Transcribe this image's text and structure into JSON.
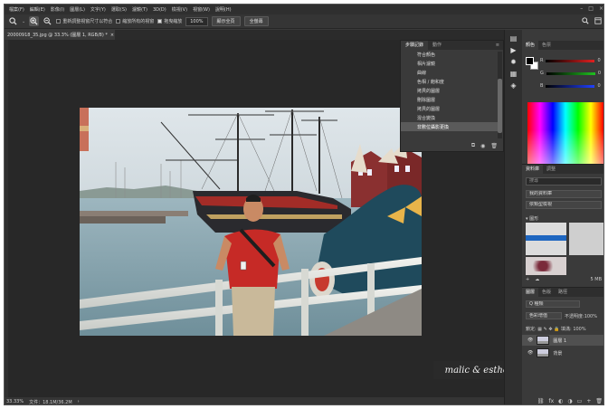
{
  "menu": [
    "檔案(F)",
    "編輯(E)",
    "影像(I)",
    "圖層(L)",
    "文字(Y)",
    "選取(S)",
    "濾鏡(T)",
    "3D(D)",
    "檢視(V)",
    "視窗(W)",
    "說明(H)"
  ],
  "options": {
    "resize_windows": "重新調整視窗尺寸以符合",
    "zoom_all_windows": "縮放所有的視窗",
    "scrubby_zoom": "拖曳縮放",
    "zoom_value": "100%",
    "fit_screen": "顯示全頁",
    "fill_screen": "全螢幕"
  },
  "document_tab": {
    "title": "20000918_35.jpg @ 33.3% (圖層 1, RGB/8) *",
    "close": "×"
  },
  "history": {
    "tabs": [
      "步驟記錄",
      "動作"
    ],
    "items": [
      "符合顏色",
      "相片濾鏡",
      "曲線",
      "色相 / 飽和度",
      "拷貝的圖層",
      "刪除圖層",
      "拷貝的圖層",
      "混合變換",
      "非數位攝影更換"
    ],
    "selected_index": 8
  },
  "color_panel": {
    "tabs": [
      "顏色",
      "色票"
    ],
    "r_label": "R",
    "g_label": "G",
    "b_label": "B",
    "r_value": "0",
    "g_value": "0",
    "b_value": "0",
    "colors": {
      "r": "#e02020",
      "g": "#20c020",
      "b": "#2040ff"
    }
  },
  "library": {
    "tabs": [
      "資料庫",
      "調整"
    ],
    "search_placeholder": "搜尋",
    "view_mode": "我的資料庫",
    "view_select": "依類型檢視",
    "section": "▾ 圖形",
    "size": "5 MB"
  },
  "layers": {
    "tabs": [
      "圖層",
      "色版",
      "路徑"
    ],
    "kind": "Q 種類",
    "blend_mode": "色彩增值",
    "opacity_label": "不透明度:",
    "opacity_value": "100%",
    "lock_label": "鎖定:",
    "fill_label": "填滿:",
    "fill_value": "100%",
    "items": [
      {
        "name": "圖層 1",
        "selected": true
      },
      {
        "name": "背景",
        "selected": false
      }
    ]
  },
  "status": {
    "zoom": "33.33%",
    "doc_info": "文件：18.1M/36.2M"
  },
  "watermark": "malic & esther's underdog"
}
